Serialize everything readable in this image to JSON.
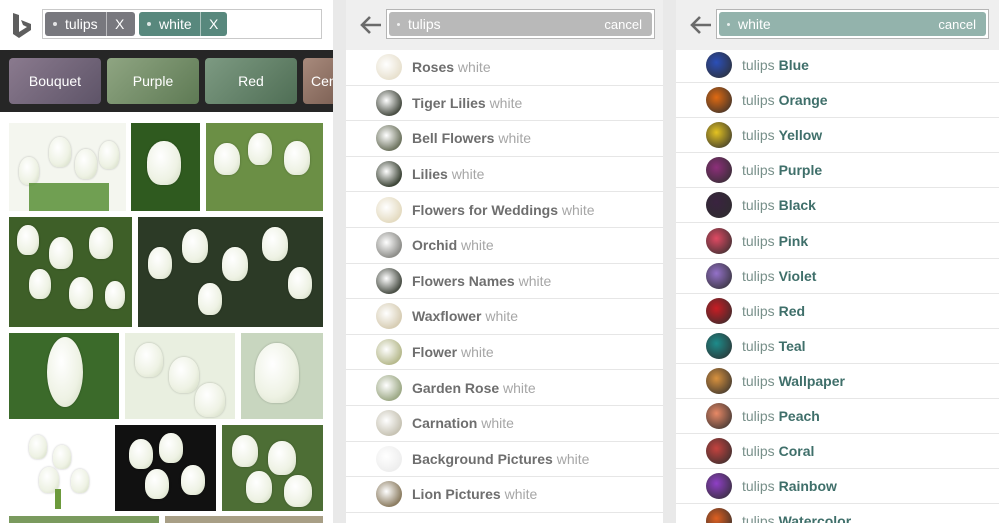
{
  "panel1": {
    "chips": [
      {
        "label": "tulips",
        "remove": "X"
      },
      {
        "label": "white",
        "remove": "X"
      }
    ],
    "filters": [
      "Bouquet",
      "Purple",
      "Red",
      "Cen"
    ]
  },
  "panel2": {
    "query": "tulips",
    "cancel": "cancel",
    "suggestions": [
      {
        "main": "Roses",
        "suffix": "white"
      },
      {
        "main": "Tiger Lilies",
        "suffix": "white"
      },
      {
        "main": "Bell Flowers",
        "suffix": "white"
      },
      {
        "main": "Lilies",
        "suffix": "white"
      },
      {
        "main": "Flowers for Weddings",
        "suffix": "white"
      },
      {
        "main": "Orchid",
        "suffix": "white"
      },
      {
        "main": "Flowers Names",
        "suffix": "white"
      },
      {
        "main": "Waxflower",
        "suffix": "white"
      },
      {
        "main": "Flower",
        "suffix": "white"
      },
      {
        "main": "Garden Rose",
        "suffix": "white"
      },
      {
        "main": "Carnation",
        "suffix": "white"
      },
      {
        "main": "Background Pictures",
        "suffix": "white"
      },
      {
        "main": "Lion Pictures",
        "suffix": "white"
      }
    ]
  },
  "panel3": {
    "query": "white",
    "cancel": "cancel",
    "suggestions": [
      {
        "prefix": "tulips",
        "main": "Blue"
      },
      {
        "prefix": "tulips",
        "main": "Orange"
      },
      {
        "prefix": "tulips",
        "main": "Yellow"
      },
      {
        "prefix": "tulips",
        "main": "Purple"
      },
      {
        "prefix": "tulips",
        "main": "Black"
      },
      {
        "prefix": "tulips",
        "main": "Pink"
      },
      {
        "prefix": "tulips",
        "main": "Violet"
      },
      {
        "prefix": "tulips",
        "main": "Red"
      },
      {
        "prefix": "tulips",
        "main": "Teal"
      },
      {
        "prefix": "tulips",
        "main": "Wallpaper"
      },
      {
        "prefix": "tulips",
        "main": "Peach"
      },
      {
        "prefix": "tulips",
        "main": "Coral"
      },
      {
        "prefix": "tulips",
        "main": "Rainbow"
      },
      {
        "prefix": "tulips",
        "main": "Watercolor"
      }
    ]
  },
  "colors": {
    "chip_gray": "#78787e",
    "chip_teal": "#58887d",
    "query_gray": "#b9b9b9",
    "query_teal": "#93b3ac",
    "thumbs_panel2": [
      "#e8e1cf",
      "#4a4f45",
      "#6f7561",
      "#3e4638",
      "#e4dbc1",
      "#8e8e8a",
      "#4b5047",
      "#d7cdb4",
      "#b7ba8e",
      "#9eaa87",
      "#c7c3b4",
      "#eeeeee",
      "#8c7d62"
    ],
    "thumbs_panel3": [
      "#2b4fb8",
      "#e06a12",
      "#e4c321",
      "#8d2f7a",
      "#3a2340",
      "#e04a63",
      "#9471c9",
      "#c91d24",
      "#1d8c8b",
      "#d9923e",
      "#e88966",
      "#c5433f",
      "#8f3fc6",
      "#e06020"
    ]
  }
}
